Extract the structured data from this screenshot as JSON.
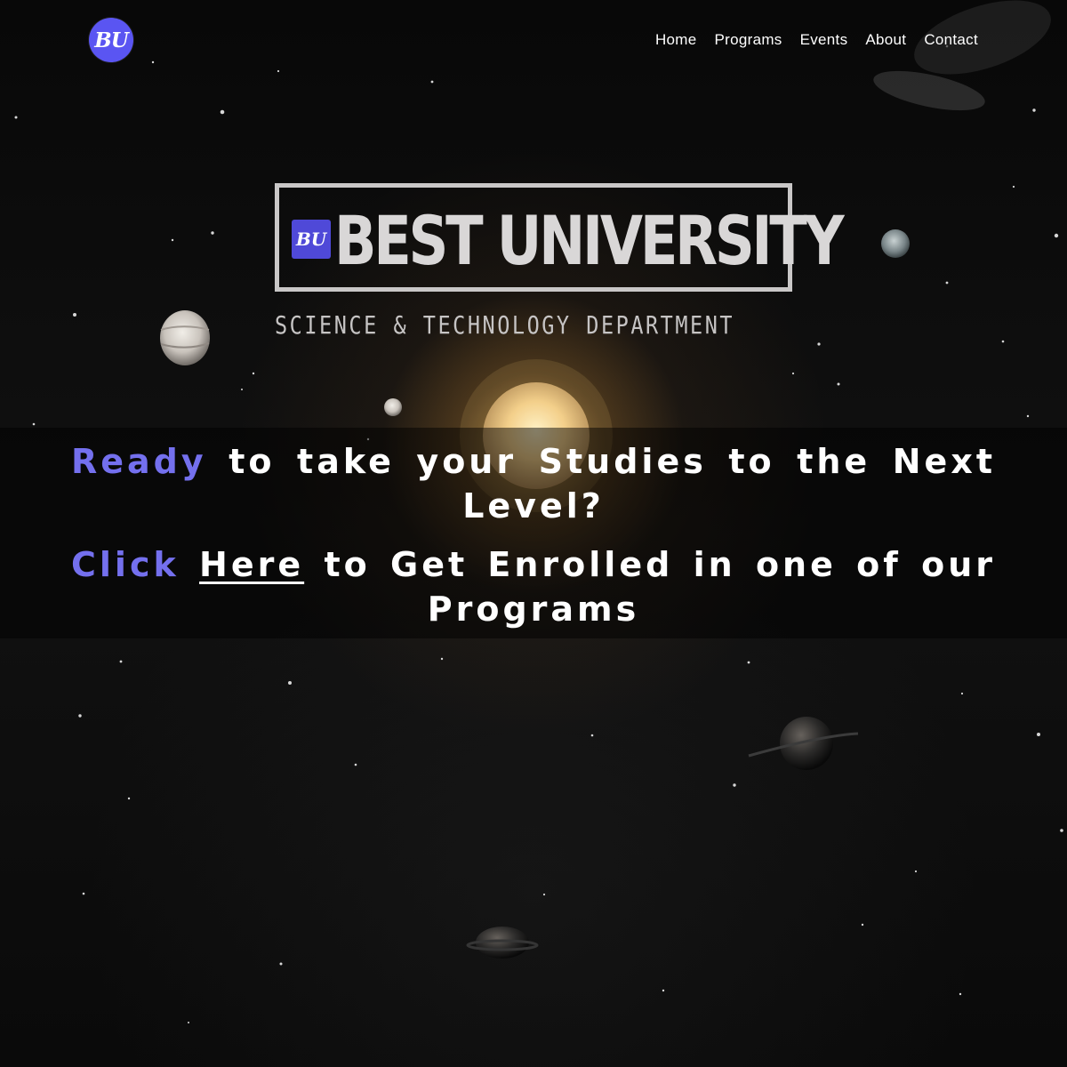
{
  "navigation": {
    "logo_text": "BU",
    "links": [
      {
        "label": "Home"
      },
      {
        "label": "Programs"
      },
      {
        "label": "Events"
      },
      {
        "label": "About"
      },
      {
        "label": "Contact"
      }
    ]
  },
  "hero": {
    "brand_badge": "BU",
    "brand_title": "BEST UNIVERSITY",
    "department": "SCIENCE & TECHNOLOGY DEPARTMENT"
  },
  "cta": {
    "line_one_accent": "Ready",
    "line_one_rest": "to take your Studies to the Next Level?",
    "line_two_accent": "Click",
    "line_two_link": "Here",
    "line_two_rest": "to Get Enrolled in one of our Programs"
  },
  "colors": {
    "accent": "#7470ee",
    "logo_background": "#5a55f2",
    "overlay": "#000000",
    "text": "#ffffff"
  }
}
